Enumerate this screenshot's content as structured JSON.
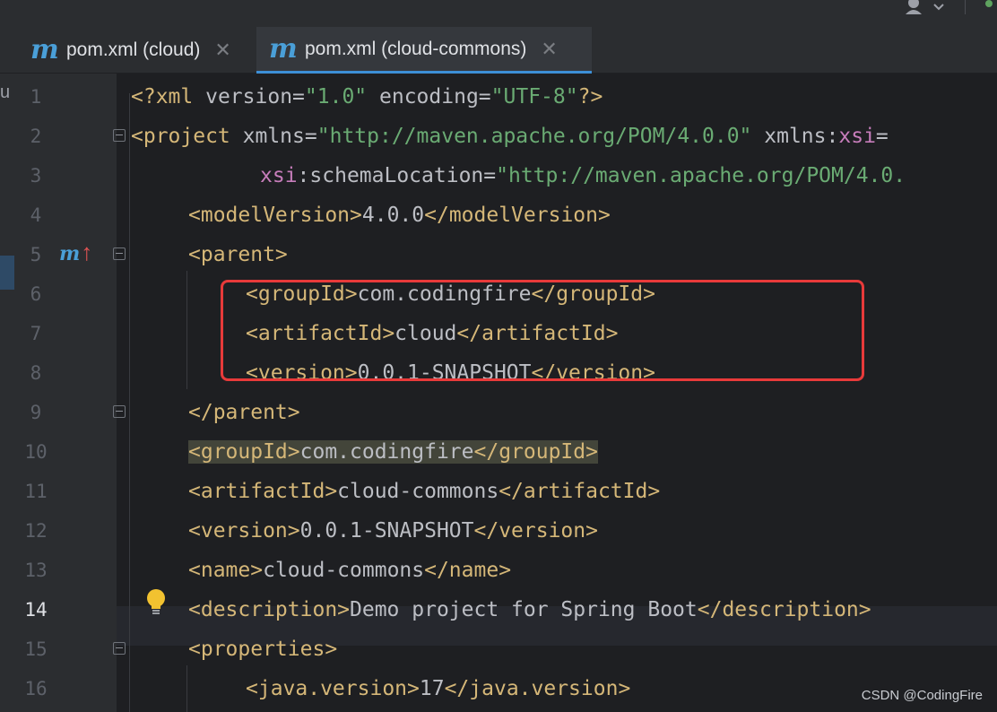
{
  "tabs": [
    {
      "icon": "maven-icon",
      "label": "pom.xml (cloud)",
      "close": "✕",
      "active": false
    },
    {
      "icon": "maven-icon",
      "label": "pom.xml (cloud-commons)",
      "close": "✕",
      "active": true
    }
  ],
  "left_panel_char": "u",
  "editor": {
    "current_line": 14,
    "lines": [
      {
        "n": "1"
      },
      {
        "n": "2"
      },
      {
        "n": "3"
      },
      {
        "n": "4"
      },
      {
        "n": "5"
      },
      {
        "n": "6"
      },
      {
        "n": "7"
      },
      {
        "n": "8"
      },
      {
        "n": "9"
      },
      {
        "n": "10"
      },
      {
        "n": "11"
      },
      {
        "n": "12"
      },
      {
        "n": "13"
      },
      {
        "n": "14"
      },
      {
        "n": "15"
      },
      {
        "n": "16"
      }
    ],
    "code": {
      "l1": {
        "lt": "<?",
        "tag": "xml",
        "a1": "version",
        "eq": "=",
        "v1": "\"1.0\"",
        "a2": "encoding",
        "v2": "\"UTF-8\"",
        "end": "?>"
      },
      "l2": {
        "open": "<project",
        "a1": "xmlns",
        "eq": "=",
        "v1": "\"http://maven.apache.org/POM/4.0.0\"",
        "a2": "xmlns",
        "colon": ":",
        "ns": "xsi",
        "eq2": "="
      },
      "l3": {
        "ns": "xsi",
        "colon": ":",
        "attr": "schemaLocation",
        "eq": "=",
        "v": "\"http://maven.apache.org/POM/4.0."
      },
      "l4": {
        "open": "<modelVersion>",
        "text": "4.0.0",
        "close": "</modelVersion>"
      },
      "l5": {
        "open": "<parent>"
      },
      "l6": {
        "open": "<groupId>",
        "text": "com.codingfire",
        "close": "</groupId>"
      },
      "l7": {
        "open": "<artifactId>",
        "text": "cloud",
        "close": "</artifactId>"
      },
      "l8": {
        "open": "<version>",
        "text": "0.0.1-SNAPSHOT",
        "close": "</version>"
      },
      "l9": {
        "close": "</parent>"
      },
      "l10": {
        "open": "<groupId>",
        "text": "com.codingfire",
        "close": "</groupId>"
      },
      "l11": {
        "open": "<artifactId>",
        "text": "cloud-commons",
        "close": "</artifactId>"
      },
      "l12": {
        "open": "<version>",
        "text": "0.0.1-SNAPSHOT",
        "close": "</version>"
      },
      "l13": {
        "open": "<name>",
        "text": "cloud-commons",
        "close": "</name>"
      },
      "l14": {
        "open": "<description>",
        "text": "Demo project for Spring Boot",
        "close": "</description>"
      },
      "l15": {
        "open": "<properties>"
      },
      "l16": {
        "open": "<java.version>",
        "text": "17",
        "close": "</java.version>"
      }
    }
  },
  "gutter_marker": {
    "letter": "m",
    "arrow": "↑"
  },
  "watermark": "CSDN @CodingFire",
  "colors": {
    "tag": "#d5b778",
    "string": "#6aab73",
    "namespace": "#c77dbb",
    "text": "#bcbec4",
    "annotation_box": "#e83a3a",
    "tab_active_underline": "#3d8fd6"
  }
}
